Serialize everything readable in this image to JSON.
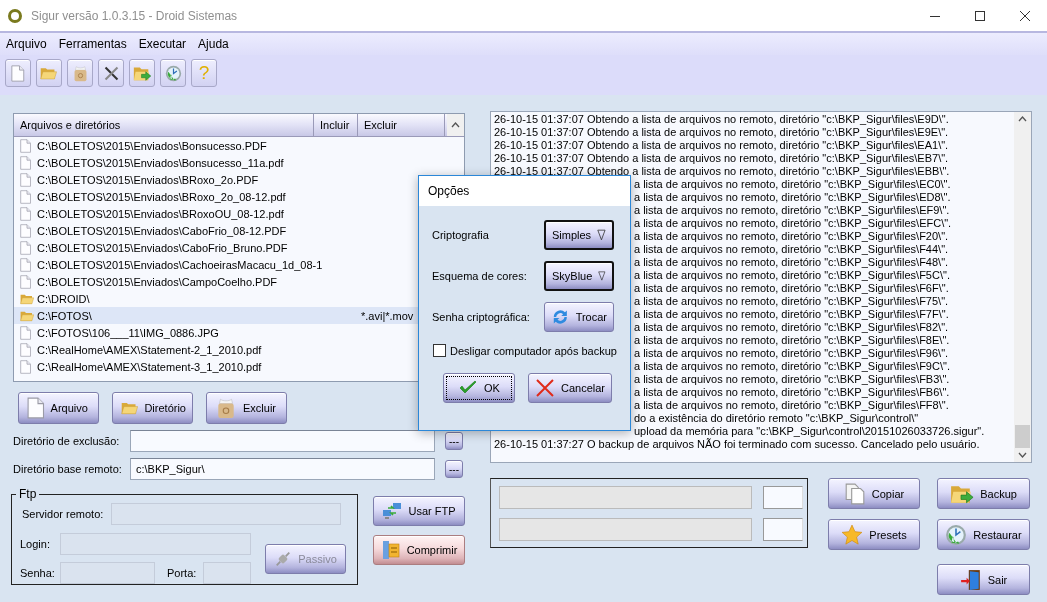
{
  "window": {
    "title": "Sigur versão 1.0.3.15 - Droid Sistemas"
  },
  "menu": [
    "Arquivo",
    "Ferramentas",
    "Executar",
    "Ajuda"
  ],
  "toolbar": [
    {
      "kind": "new"
    },
    {
      "kind": "open"
    },
    {
      "kind": "bag"
    },
    {
      "kind": "tools"
    },
    {
      "kind": "backup"
    },
    {
      "kind": "restore"
    },
    {
      "kind": "help",
      "label": "?"
    }
  ],
  "file_list": {
    "columns": [
      "Arquivos e diretórios",
      "Incluir",
      "Excluir"
    ],
    "rows": [
      {
        "kind": "file",
        "path": "C:\\BOLETOS\\2015\\Enviados\\Bonsucesso.PDF",
        "selected": false
      },
      {
        "kind": "file",
        "path": "C:\\BOLETOS\\2015\\Enviados\\Bonsucesso_11a.pdf",
        "selected": false
      },
      {
        "kind": "file",
        "path": "C:\\BOLETOS\\2015\\Enviados\\BRoxo_2o.PDF",
        "selected": false
      },
      {
        "kind": "file",
        "path": "C:\\BOLETOS\\2015\\Enviados\\BRoxo_2o_08-12.pdf",
        "selected": false
      },
      {
        "kind": "file",
        "path": "C:\\BOLETOS\\2015\\Enviados\\BRoxoOU_08-12.pdf",
        "selected": false
      },
      {
        "kind": "file",
        "path": "C:\\BOLETOS\\2015\\Enviados\\CaboFrio_08-12.PDF",
        "selected": false
      },
      {
        "kind": "file",
        "path": "C:\\BOLETOS\\2015\\Enviados\\CaboFrio_Bruno.PDF",
        "selected": false
      },
      {
        "kind": "file",
        "path": "C:\\BOLETOS\\2015\\Enviados\\CachoeirasMacacu_1d_08-1",
        "selected": false
      },
      {
        "kind": "file",
        "path": "C:\\BOLETOS\\2015\\Enviados\\CampoCoelho.PDF",
        "selected": false
      },
      {
        "kind": "folder",
        "path": "C:\\DROID\\",
        "selected": false
      },
      {
        "kind": "folder",
        "path": "C:\\FOTOS\\",
        "exclude": "*.avi|*.mov",
        "selected": true
      },
      {
        "kind": "file",
        "path": "C:\\FOTOS\\106___11\\IMG_0886.JPG",
        "selected": false
      },
      {
        "kind": "file",
        "path": "C:\\RealHome\\AMEX\\Statement-2_1_2010.pdf",
        "selected": false
      },
      {
        "kind": "file",
        "path": "C:\\RealHome\\AMEX\\Statement-3_1_2010.pdf",
        "selected": false
      }
    ]
  },
  "file_buttons": [
    {
      "kind": "file",
      "label": "Arquivo"
    },
    {
      "kind": "folder",
      "label": "Diretório"
    },
    {
      "kind": "bag",
      "label": "Excluir"
    }
  ],
  "fields": [
    {
      "label": "Diretório de exclusão:",
      "browse": "---"
    },
    {
      "label": "Diretório base remoto:",
      "value": "c:\\BKP_Sigur\\",
      "browse": "---"
    }
  ],
  "ftp": {
    "title": "Ftp",
    "server": {
      "label": "Servidor remoto:",
      "disabled": true
    },
    "login": {
      "label": "Login:",
      "disabled": true
    },
    "password": {
      "label": "Senha:",
      "disabled": true
    },
    "port": {
      "label": "Porta:",
      "disabled": true
    },
    "passive": {
      "label": "Passivo",
      "disabled": true
    }
  },
  "side_buttons": [
    {
      "kind": "ftp",
      "label": "Usar FTP",
      "pressed": false
    },
    {
      "kind": "compress",
      "label": "Comprimir",
      "pressed": true
    }
  ],
  "log": {
    "lines": [
      {
        "kind": "full",
        "text": "26-10-15 01:37:07 Obtendo a lista de arquivos no remoto, diretório \"c:\\BKP_Sigur\\files\\E9D\\\"."
      },
      {
        "kind": "full",
        "text": "26-10-15 01:37:07 Obtendo a lista de arquivos no remoto, diretório \"c:\\BKP_Sigur\\files\\E9E\\\"."
      },
      {
        "kind": "full",
        "text": "26-10-15 01:37:07 Obtendo a lista de arquivos no remoto, diretório \"c:\\BKP_Sigur\\files\\EA1\\\"."
      },
      {
        "kind": "full",
        "text": "26-10-15 01:37:07 Obtendo a lista de arquivos no remoto, diretório \"c:\\BKP_Sigur\\files\\EB7\\\"."
      },
      {
        "kind": "full",
        "text": "26-10-15 01:37:07 Obtendo a lista de arquivos no remoto, diretório \"c:\\BKP_Sigur\\files\\EBB\\\"."
      },
      {
        "kind": "cut",
        "text": "a lista de arquivos no remoto, diretório \"c:\\BKP_Sigur\\files\\EC0\\\"."
      },
      {
        "kind": "cut",
        "text": "a lista de arquivos no remoto, diretório \"c:\\BKP_Sigur\\files\\ED8\\\"."
      },
      {
        "kind": "cut",
        "text": "a lista de arquivos no remoto, diretório \"c:\\BKP_Sigur\\files\\EF9\\\"."
      },
      {
        "kind": "cut",
        "text": "a lista de arquivos no remoto, diretório \"c:\\BKP_Sigur\\files\\EFC\\\"."
      },
      {
        "kind": "cut",
        "text": "a lista de arquivos no remoto, diretório \"c:\\BKP_Sigur\\files\\F20\\\"."
      },
      {
        "kind": "cut",
        "text": "a lista de arquivos no remoto, diretório \"c:\\BKP_Sigur\\files\\F44\\\"."
      },
      {
        "kind": "cut",
        "text": "a lista de arquivos no remoto, diretório \"c:\\BKP_Sigur\\files\\F48\\\"."
      },
      {
        "kind": "cut",
        "text": "a lista de arquivos no remoto, diretório \"c:\\BKP_Sigur\\files\\F5C\\\"."
      },
      {
        "kind": "cut",
        "text": "a lista de arquivos no remoto, diretório \"c:\\BKP_Sigur\\files\\F6F\\\"."
      },
      {
        "kind": "cut",
        "text": "a lista de arquivos no remoto, diretório \"c:\\BKP_Sigur\\files\\F75\\\"."
      },
      {
        "kind": "cut",
        "text": "a lista de arquivos no remoto, diretório \"c:\\BKP_Sigur\\files\\F7F\\\"."
      },
      {
        "kind": "cut",
        "text": "a lista de arquivos no remoto, diretório \"c:\\BKP_Sigur\\files\\F82\\\"."
      },
      {
        "kind": "cut",
        "text": "a lista de arquivos no remoto, diretório \"c:\\BKP_Sigur\\files\\F8E\\\"."
      },
      {
        "kind": "cut",
        "text": "a lista de arquivos no remoto, diretório \"c:\\BKP_Sigur\\files\\F96\\\"."
      },
      {
        "kind": "cut",
        "text": "a lista de arquivos no remoto, diretório \"c:\\BKP_Sigur\\files\\F9C\\\"."
      },
      {
        "kind": "cut",
        "text": "a lista de arquivos no remoto, diretório \"c:\\BKP_Sigur\\files\\FB3\\\"."
      },
      {
        "kind": "cut",
        "text": "a lista de arquivos no remoto, diretório \"c:\\BKP_Sigur\\files\\FB6\\\"."
      },
      {
        "kind": "cut",
        "text": "a lista de arquivos no remoto, diretório \"c:\\BKP_Sigur\\files\\FF8\\\"."
      },
      {
        "kind": "cut",
        "text": "do a existência do diretório remoto \"c:\\BKP_Sigur\\control\\\""
      },
      {
        "kind": "cut",
        "text": "upload da memória para \"c:\\BKP_Sigur\\control\\20151026033726.sigur\"."
      },
      {
        "kind": "full",
        "text": "26-10-15 01:37:27 O backup de arquivos NÃO foi terminado com sucesso. Cancelado pelo usuário."
      }
    ]
  },
  "progress": [
    {
      "disabled": true
    },
    {
      "disabled": true
    }
  ],
  "actions": [
    {
      "kind": "copy",
      "label": "Copiar"
    },
    {
      "kind": "backup",
      "label": "Backup"
    },
    {
      "kind": "star",
      "label": "Presets"
    },
    {
      "kind": "restore",
      "label": "Restaurar"
    },
    {
      "kind": "exit",
      "label": "Sair"
    }
  ],
  "dialog": {
    "title": "Opções",
    "rows": [
      {
        "kind": "dropdown",
        "label": "Criptografia",
        "value": "Simples"
      },
      {
        "kind": "dropdown",
        "label": "Esquema de cores:",
        "value": "SkyBlue"
      },
      {
        "kind": "button",
        "label": "Senha criptográfica:",
        "value": "Trocar"
      }
    ],
    "checkbox": {
      "label": "Desligar computador após backup",
      "checked": false
    },
    "buttons": [
      {
        "kind": "check",
        "label": "OK",
        "focused": true
      },
      {
        "kind": "cross",
        "label": "Cancelar",
        "focused": false
      }
    ]
  }
}
